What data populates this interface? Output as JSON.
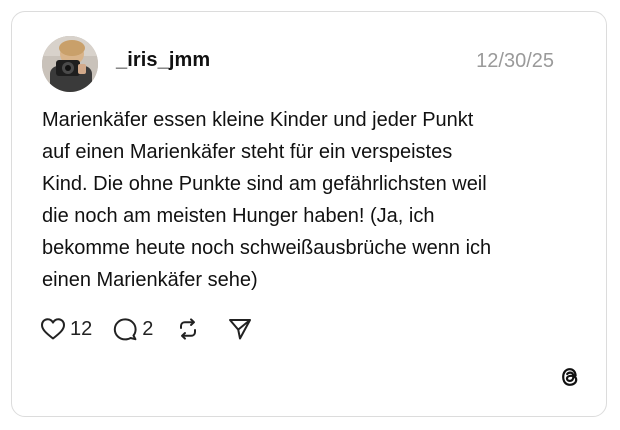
{
  "post": {
    "username": "_iris_jmm",
    "date": "12/30/25",
    "text_lines": [
      "Marienkäfer essen kleine Kinder und jeder Punkt",
      "auf einen Marienkäfer steht für ein verspeistes",
      "Kind. Die ohne Punkte sind am gefährlichsten weil",
      "die noch am meisten Hunger haben! (Ja, ich",
      "bekomme heute noch schweißausbrüche wenn ich",
      "einen Marienkäfer sehe)"
    ]
  },
  "actions": {
    "likes": "12",
    "replies": "2",
    "icons": [
      "heart-icon",
      "comment-icon",
      "repost-icon",
      "share-icon"
    ]
  },
  "branding": {
    "logo": "threads-logo-icon"
  },
  "colors": {
    "text": "#111111",
    "muted": "#9a9a9a",
    "border": "#dcdcdc",
    "background": "#ffffff"
  }
}
